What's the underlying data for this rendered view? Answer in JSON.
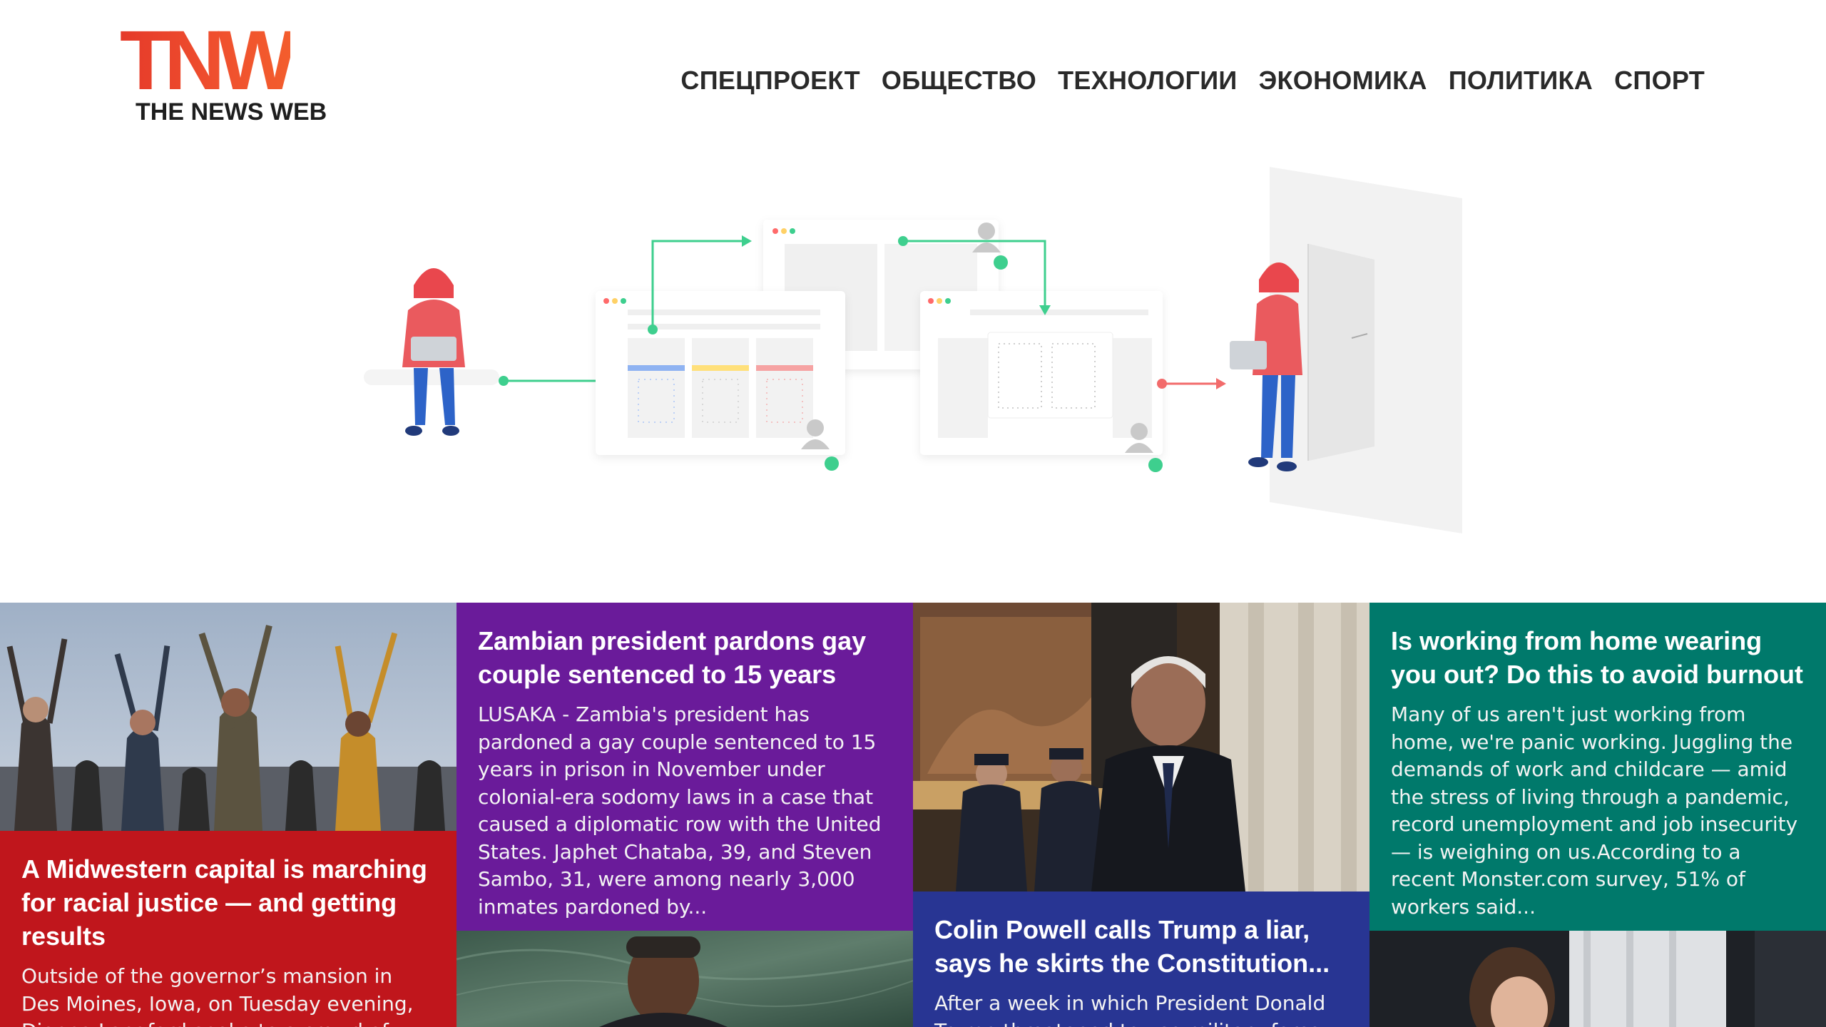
{
  "site": {
    "logo_mark": "TNW",
    "logo_sub": "THE NEWS WEB"
  },
  "nav": [
    {
      "label": "СПЕЦПРОЕКТ"
    },
    {
      "label": "ОБЩЕСТВО"
    },
    {
      "label": "ТЕХНОЛОГИИ"
    },
    {
      "label": "ЭКОНОМИКА"
    },
    {
      "label": "ПОЛИТИКА"
    },
    {
      "label": "СПОРТ"
    }
  ],
  "colors": {
    "red": "#c0161c",
    "purple": "#6a1b9a",
    "indigo": "#283593",
    "teal": "#00796b",
    "accent_green": "#3ecf8e",
    "logo_orange": "#e8432b"
  },
  "cards": [
    {
      "title": "A Midwestern capital is marching for racial justice — and getting results",
      "excerpt": "Outside of the governor’s mansion in Des Moines, Iowa, on Tuesday evening, Dionna Langford spoke to a crowd of",
      "color": "#c0161c"
    },
    {
      "title": "Zambian president pardons gay couple sentenced to 15 years",
      "excerpt": "LUSAKA - Zambia's president has pardoned a gay couple sentenced to 15 years in prison in November under colonial-era sodomy laws in a case that caused a diplomatic row with the United States. Japhet Chataba, 39, and Steven Sambo, 31, were among nearly 3,000 inmates pardoned by...",
      "color": "#6a1b9a"
    },
    {
      "title": "Colin Powell calls Trump a liar, says he skirts the Constitution...",
      "excerpt": "After a week in which President Donald Trump threatened to use military force",
      "color": "#283593"
    },
    {
      "title": "Is working from home wearing you out? Do this to avoid burnout",
      "excerpt": "Many of us aren't just working from home, we're panic working. Juggling the demands of work and childcare — amid the stress of living through a pandemic, record unemployment and job insecurity — is weighing on us.According to a recent Monster.com survey, 51% of workers said...",
      "color": "#00796b"
    }
  ]
}
